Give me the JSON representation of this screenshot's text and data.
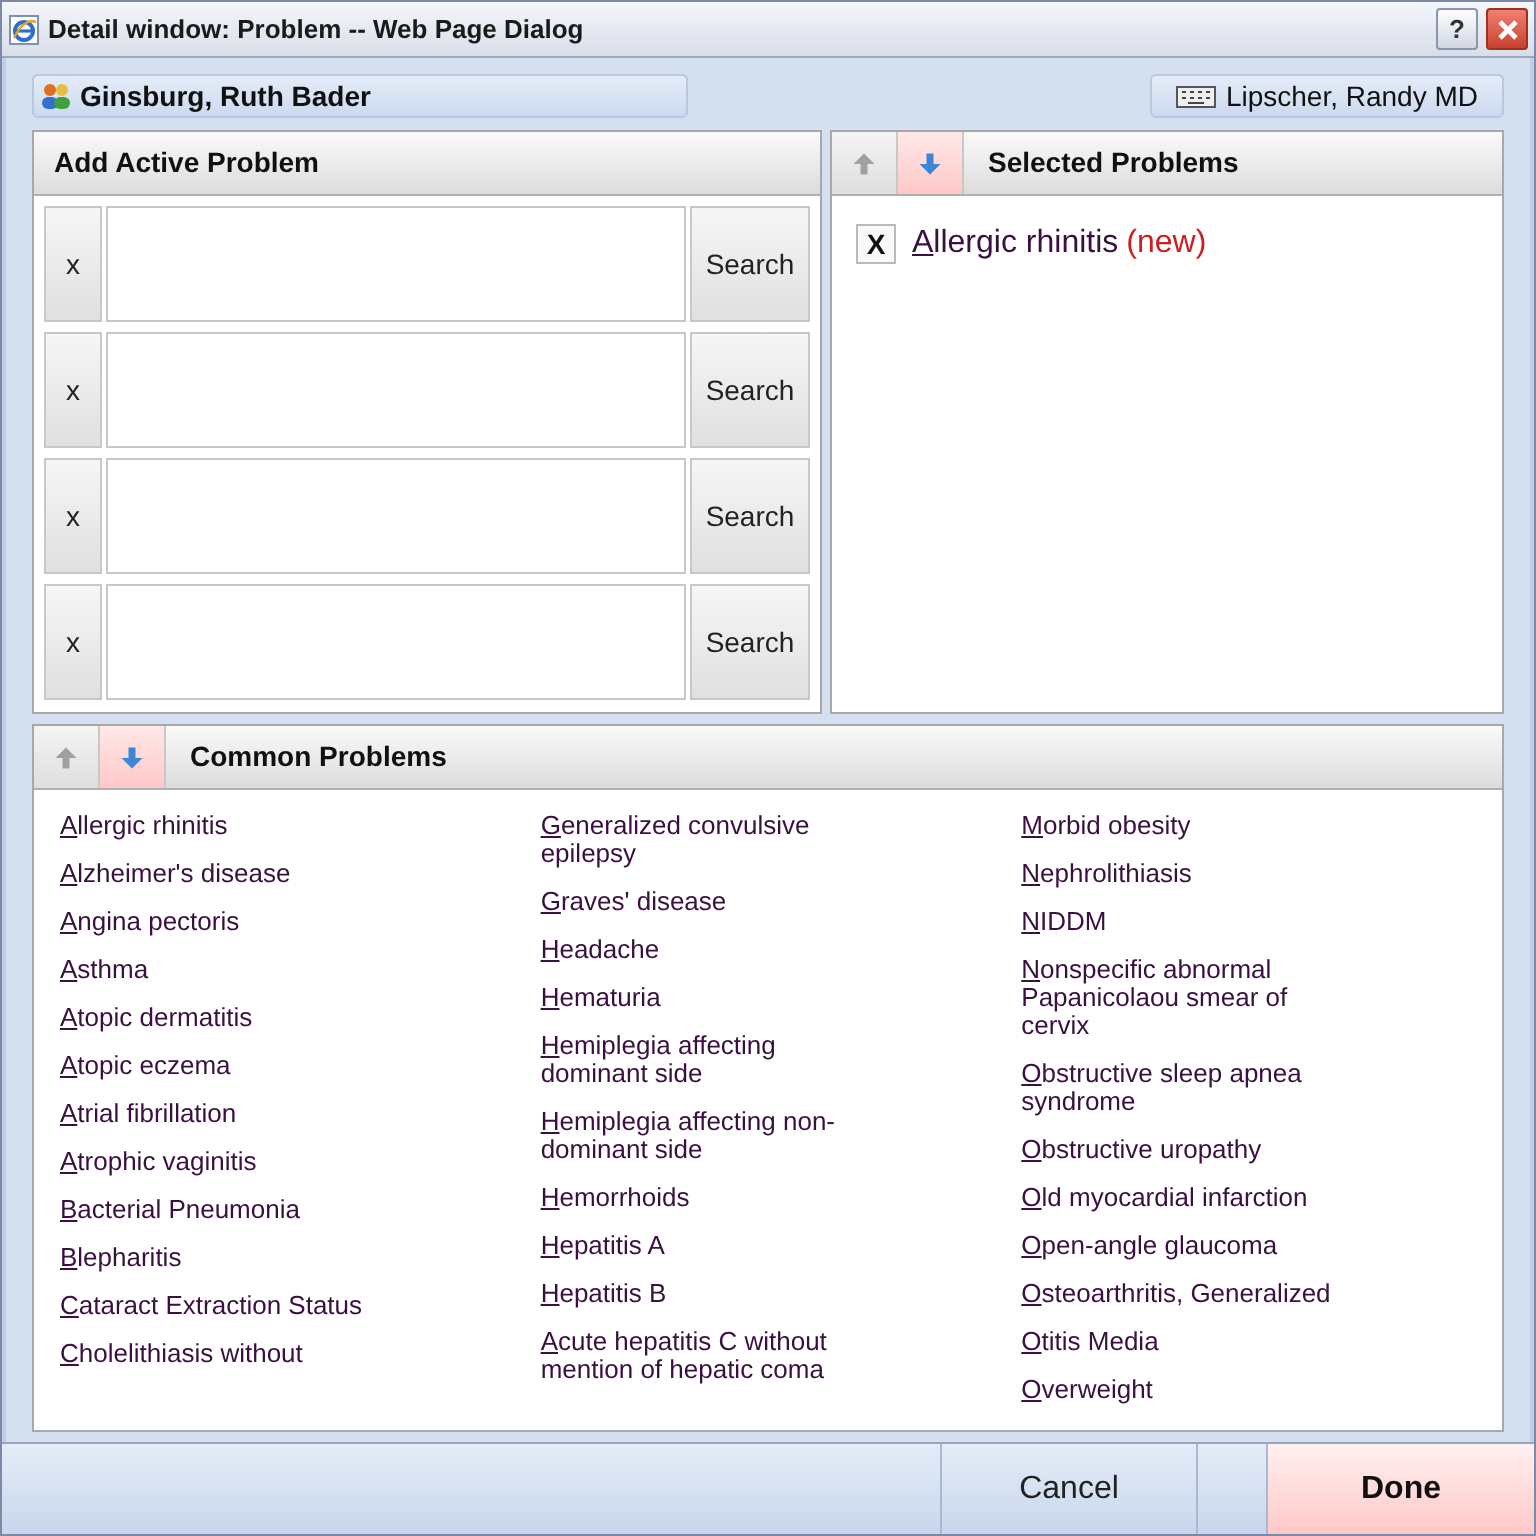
{
  "window": {
    "title": "Detail window: Problem -- Web Page Dialog",
    "help_label": "?"
  },
  "patient": {
    "name": "Ginsburg, Ruth Bader"
  },
  "provider": {
    "name": "Lipscher, Randy MD"
  },
  "add_panel": {
    "title": "Add Active Problem",
    "rows": [
      {
        "clear_label": "x",
        "value": "",
        "search_label": "Search"
      },
      {
        "clear_label": "x",
        "value": "",
        "search_label": "Search"
      },
      {
        "clear_label": "x",
        "value": "",
        "search_label": "Search"
      },
      {
        "clear_label": "x",
        "value": "",
        "search_label": "Search"
      }
    ]
  },
  "selected_panel": {
    "title": "Selected Problems",
    "sort_buttons": [
      {
        "kind": "up",
        "disabled": true
      },
      {
        "kind": "down",
        "disabled": false
      }
    ],
    "items": [
      {
        "remove_label": "X",
        "name": "Allergic rhinitis",
        "tag": "(new)"
      }
    ]
  },
  "common_panel": {
    "title": "Common Problems",
    "sort_buttons": [
      {
        "kind": "up",
        "disabled": true
      },
      {
        "kind": "down",
        "disabled": false
      }
    ],
    "columns": [
      [
        "Allergic rhinitis",
        "Alzheimer's disease",
        "Angina pectoris",
        "Asthma",
        "Atopic dermatitis",
        "Atopic eczema",
        "Atrial fibrillation",
        "Atrophic vaginitis",
        "Bacterial Pneumonia",
        "Blepharitis",
        "Cataract Extraction Status",
        "Cholelithiasis without"
      ],
      [
        "Generalized convulsive epilepsy",
        "Graves' disease",
        "Headache",
        "Hematuria",
        "Hemiplegia affecting dominant side",
        "Hemiplegia affecting non-dominant side",
        "Hemorrhoids",
        "Hepatitis A",
        "Hepatitis B",
        "Acute hepatitis C without mention of hepatic coma"
      ],
      [
        "Morbid obesity",
        "Nephrolithiasis",
        "NIDDM",
        "Nonspecific abnormal Papanicolaou smear of cervix",
        "Obstructive sleep apnea syndrome",
        "Obstructive uropathy",
        "Old myocardial infarction",
        "Open-angle glaucoma",
        "Osteoarthritis, Generalized",
        "Otitis Media",
        "Overweight"
      ]
    ]
  },
  "buttons": {
    "cancel": "Cancel",
    "done": "Done"
  }
}
